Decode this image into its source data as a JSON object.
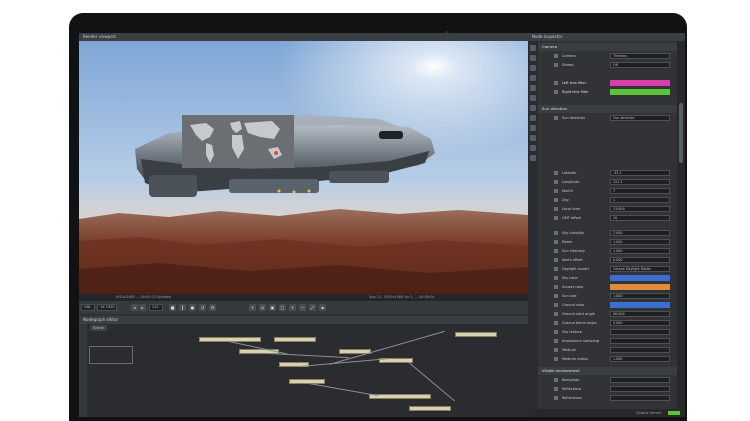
{
  "render_viewport": {
    "title": "Render viewport"
  },
  "status_bar": {
    "left_text": "1920x1080 ... 00:00:23 Window",
    "right_text": "Spp 12, 1920x1080 Hz 2, ... 00:00:04"
  },
  "toolbar": {
    "mode_value": "GRL",
    "zoom_value": "1X 1920",
    "frame_value": "210"
  },
  "nodegraph": {
    "title": "Nodegraph editor",
    "tab": "Scene"
  },
  "node_inspector": {
    "title": "Node inspector",
    "section_camera": "Camera",
    "section_sun": "Sun direction",
    "section_environment": "Visible environment",
    "rows": [
      {
        "label": "Camera",
        "value": "Thinlens"
      },
      {
        "label": "Stereo",
        "value": "Off"
      },
      {
        "label": "Sun direction",
        "value": "Sun direction"
      },
      {
        "label": "Latitude",
        "value": "-33.1"
      },
      {
        "label": "Longitude",
        "value": "151.2"
      },
      {
        "label": "Month",
        "value": "7"
      },
      {
        "label": "Day",
        "value": "1"
      },
      {
        "label": "Local time",
        "value": "13.000"
      },
      {
        "label": "GMT offset",
        "value": "10"
      },
      {
        "label": "Sky turbidity",
        "value": "2.000"
      },
      {
        "label": "Power",
        "value": "1.000"
      },
      {
        "label": "Sun intensity",
        "value": "1.000"
      },
      {
        "label": "North offset",
        "value": "0.000"
      },
      {
        "label": "Daylight model",
        "value": "Octane Daylight Model"
      },
      {
        "label": "Sky color",
        "value": ""
      },
      {
        "label": "Sunset color",
        "value": ""
      },
      {
        "label": "Sun size",
        "value": "1.000"
      },
      {
        "label": "Ground color",
        "value": ""
      },
      {
        "label": "Ground start angle",
        "value": "90.000"
      },
      {
        "label": "Ground blend angle",
        "value": "5.000"
      },
      {
        "label": "Sky texture",
        "value": ""
      },
      {
        "label": "Importance sampling",
        "value": ""
      },
      {
        "label": "Medium",
        "value": ""
      },
      {
        "label": "Medium radius",
        "value": "1.000"
      },
      {
        "label": "Backplate",
        "value": ""
      },
      {
        "label": "Reflections",
        "value": ""
      },
      {
        "label": "Refractions",
        "value": ""
      }
    ],
    "footer": "Octane Server"
  },
  "colors": {
    "accent_magenta": "#d63fa8",
    "accent_blue": "#3a6fd0",
    "accent_orange": "#e08a3a",
    "accent_green": "#5fc33a"
  }
}
